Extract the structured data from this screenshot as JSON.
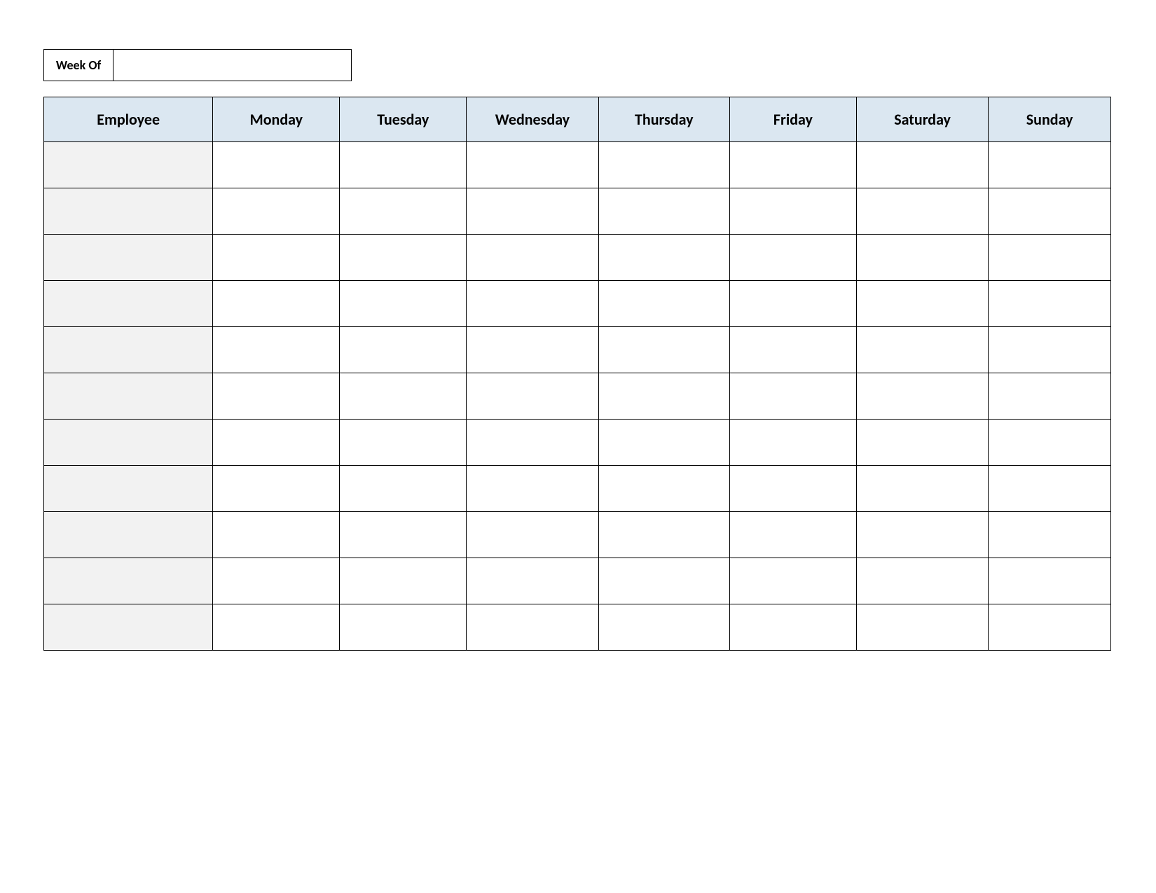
{
  "weekof": {
    "label": "Week Of",
    "value": ""
  },
  "schedule": {
    "headers": {
      "employee": "Employee",
      "mon": "Monday",
      "tue": "Tuesday",
      "wed": "Wednesday",
      "thu": "Thursday",
      "fri": "Friday",
      "sat": "Saturday",
      "sun": "Sunday"
    },
    "rows": [
      {
        "employee": "",
        "mon": "",
        "tue": "",
        "wed": "",
        "thu": "",
        "fri": "",
        "sat": "",
        "sun": ""
      },
      {
        "employee": "",
        "mon": "",
        "tue": "",
        "wed": "",
        "thu": "",
        "fri": "",
        "sat": "",
        "sun": ""
      },
      {
        "employee": "",
        "mon": "",
        "tue": "",
        "wed": "",
        "thu": "",
        "fri": "",
        "sat": "",
        "sun": ""
      },
      {
        "employee": "",
        "mon": "",
        "tue": "",
        "wed": "",
        "thu": "",
        "fri": "",
        "sat": "",
        "sun": ""
      },
      {
        "employee": "",
        "mon": "",
        "tue": "",
        "wed": "",
        "thu": "",
        "fri": "",
        "sat": "",
        "sun": ""
      },
      {
        "employee": "",
        "mon": "",
        "tue": "",
        "wed": "",
        "thu": "",
        "fri": "",
        "sat": "",
        "sun": ""
      },
      {
        "employee": "",
        "mon": "",
        "tue": "",
        "wed": "",
        "thu": "",
        "fri": "",
        "sat": "",
        "sun": ""
      },
      {
        "employee": "",
        "mon": "",
        "tue": "",
        "wed": "",
        "thu": "",
        "fri": "",
        "sat": "",
        "sun": ""
      },
      {
        "employee": "",
        "mon": "",
        "tue": "",
        "wed": "",
        "thu": "",
        "fri": "",
        "sat": "",
        "sun": ""
      },
      {
        "employee": "",
        "mon": "",
        "tue": "",
        "wed": "",
        "thu": "",
        "fri": "",
        "sat": "",
        "sun": ""
      },
      {
        "employee": "",
        "mon": "",
        "tue": "",
        "wed": "",
        "thu": "",
        "fri": "",
        "sat": "",
        "sun": ""
      }
    ]
  }
}
